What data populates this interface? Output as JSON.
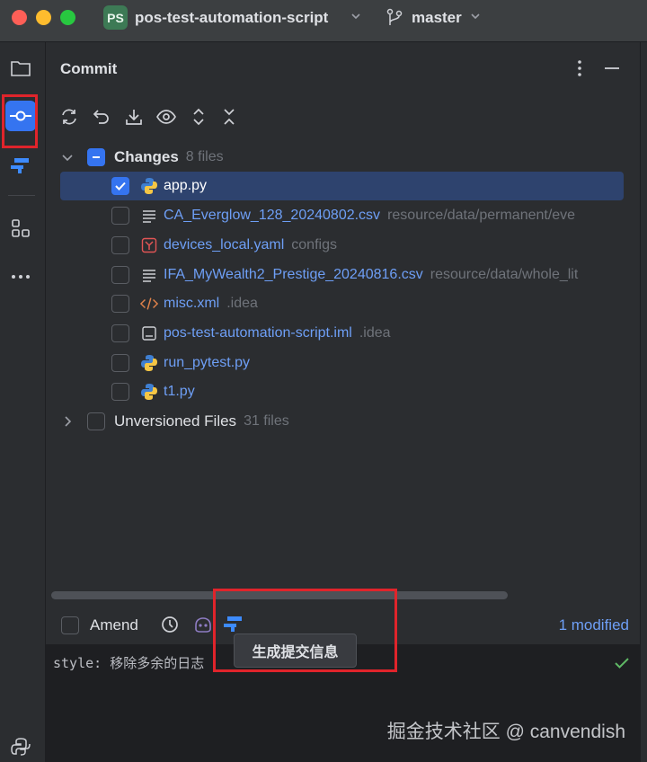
{
  "titlebar": {
    "project_badge": "PS",
    "project_name": "pos-test-automation-script",
    "branch": "master"
  },
  "panel": {
    "title": "Commit"
  },
  "changes_group": {
    "label": "Changes",
    "count": "8 files"
  },
  "files": [
    {
      "name": "app.py",
      "path": "",
      "icon": "python-icon",
      "checked": true
    },
    {
      "name": "CA_Everglow_128_20240802.csv",
      "path": "resource/data/permanent/eve",
      "icon": "csv-file-icon",
      "checked": false
    },
    {
      "name": "devices_local.yaml",
      "path": "configs",
      "icon": "yaml-file-icon",
      "checked": false
    },
    {
      "name": "IFA_MyWealth2_Prestige_20240816.csv",
      "path": "resource/data/whole_lit",
      "icon": "csv-file-icon",
      "checked": false
    },
    {
      "name": "misc.xml",
      "path": ".idea",
      "icon": "xml-file-icon",
      "checked": false
    },
    {
      "name": "pos-test-automation-script.iml",
      "path": ".idea",
      "icon": "iml-file-icon",
      "checked": false
    },
    {
      "name": "run_pytest.py",
      "path": "",
      "icon": "python-icon",
      "checked": false
    },
    {
      "name": "t1.py",
      "path": "",
      "icon": "python-icon",
      "checked": false
    }
  ],
  "unversioned_group": {
    "label": "Unversioned Files",
    "count": "31 files"
  },
  "bottom": {
    "amend_label": "Amend",
    "modified_label": "1 modified"
  },
  "editor": {
    "commit_message": "style: 移除多余的日志"
  },
  "tooltip": {
    "text": "生成提交信息"
  },
  "watermark": "掘金技术社区 @ canvendish",
  "colors": {
    "accent": "#3574f0",
    "link": "#6e9ff6",
    "highlight_box": "#e0242b",
    "background": "#2b2d30",
    "editor_bg": "#1e1f22"
  }
}
